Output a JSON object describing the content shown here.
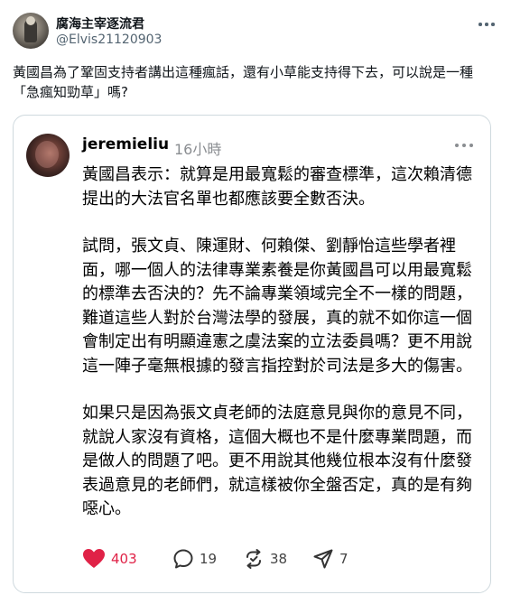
{
  "post": {
    "display_name": "腐海主宰逐流君",
    "handle": "@Elvis21120903",
    "text": "黃國昌為了鞏固支持者講出這種瘋話，還有小草能支持得下去，可以說是一種「急瘋知勁草」嗎?"
  },
  "quoted": {
    "username": "jeremieliu",
    "time": "16小時",
    "paragraphs": [
      "黃國昌表示：就算是用最寬鬆的審查標準，這次賴清德提出的大法官名單也都應該要全數否決。",
      "試問，張文貞、陳運財、何賴傑、劉靜怡這些學者裡面，哪一個人的法律專業素養是你黃國昌可以用最寬鬆的標準去否決的？先不論專業領域完全不一樣的問題，難道這些人對於台灣法學的發展，真的就不如你這一個會制定出有明顯違憲之虞法案的立法委員嗎？更不用說這一陣子毫無根據的發言指控對於司法是多大的傷害。",
      "如果只是因為張文貞老師的法庭意見與你的意見不同，就說人家沒有資格，這個大概也不是什麼專業問題，而是做人的問題了吧。更不用說其他幾位根本沒有什麼發表過意見的老師們，就這樣被你全盤否定，真的是有夠噁心。"
    ],
    "actions": {
      "likes": "403",
      "comments": "19",
      "reposts": "38",
      "shares": "7"
    }
  },
  "colors": {
    "like": "#e02247",
    "muted": "#8a8d91",
    "border": "#cfd9de"
  },
  "icons": [
    "more-icon",
    "heart-icon",
    "comment-icon",
    "repost-icon",
    "share-icon"
  ]
}
